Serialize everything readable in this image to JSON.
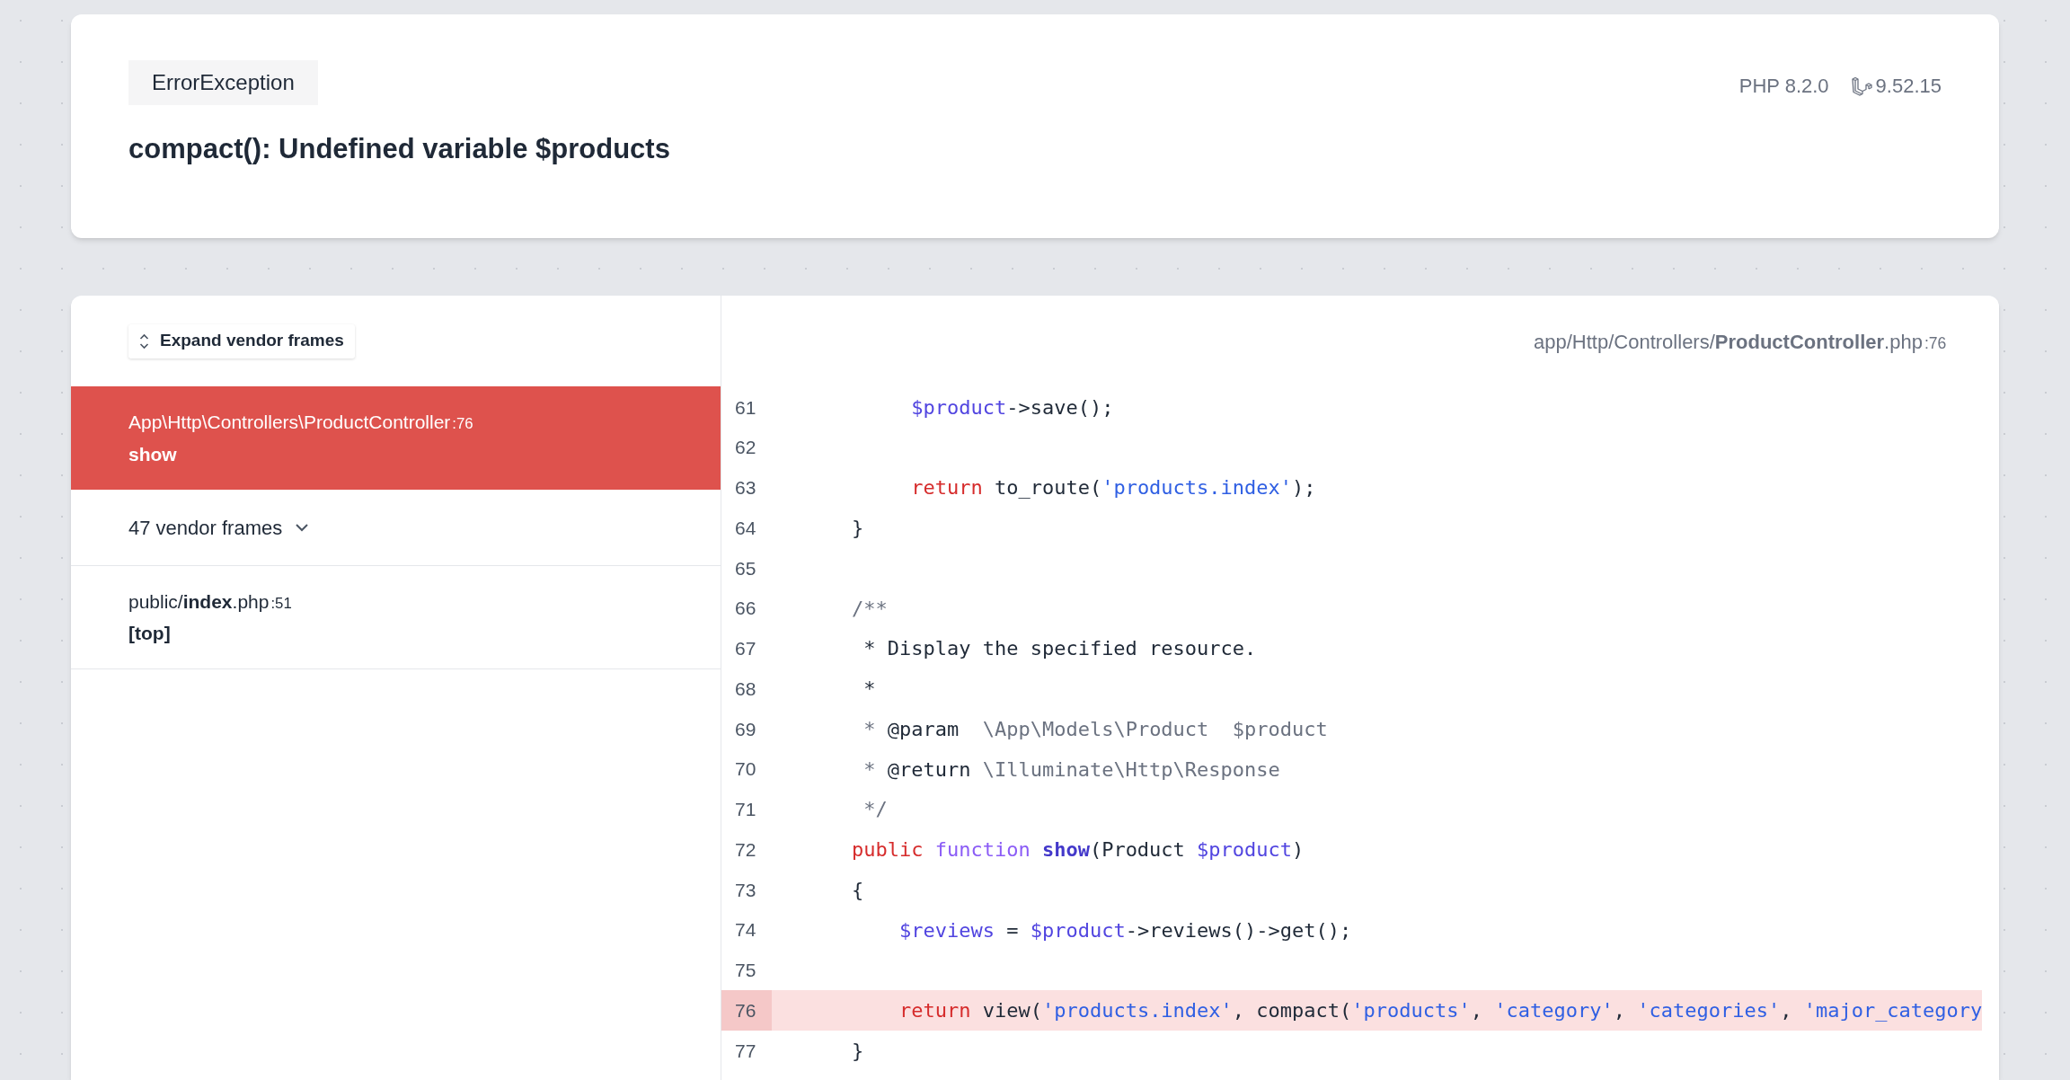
{
  "error": {
    "type": "ErrorException",
    "message": "compact(): Undefined variable $products",
    "php_version": "PHP 8.2.0",
    "laravel_version": "9.52.15"
  },
  "frames_panel": {
    "expand_button": "Expand vendor frames",
    "frames": [
      {
        "kind": "frame",
        "file": "App\\Http\\Controllers\\ProductController",
        "line": ":76",
        "method": "show",
        "selected": true
      },
      {
        "kind": "vendor_group",
        "label": "47 vendor frames",
        "expanded": false
      },
      {
        "kind": "frame",
        "file": "public/**index**.php",
        "line": ":51",
        "method": "[top]",
        "selected": false
      }
    ]
  },
  "code": {
    "file": "app/Http/Controllers/**ProductController**.php",
    "line": ":76",
    "lines": [
      {
        "number": "61",
        "highlighted": false,
        "tokens": [
          {
            "kind": "var",
            "text": "         $product"
          },
          {
            "kind": "plain",
            "text": "->save();"
          }
        ]
      },
      {
        "number": "62",
        "highlighted": false
      },
      {
        "number": "63",
        "highlighted": false,
        "tokens": [
          {
            "kind": "keyword",
            "text": "         return"
          },
          {
            "kind": "plain",
            "text": " to_route("
          },
          {
            "kind": "string",
            "text": "'products.index'"
          },
          {
            "kind": "plain",
            "text": ");"
          }
        ]
      },
      {
        "number": "64",
        "highlighted": false,
        "tokens": [
          {
            "kind": "plain",
            "text": "    }"
          }
        ]
      },
      {
        "number": "65",
        "highlighted": false
      },
      {
        "number": "66",
        "highlighted": false,
        "tokens": [
          {
            "kind": "comment",
            "text": "    /**"
          }
        ]
      },
      {
        "number": "67",
        "highlighted": false,
        "tokens": [
          {
            "kind": "plain",
            "text": "     * Display the specified resource."
          }
        ]
      },
      {
        "number": "68",
        "highlighted": false,
        "tokens": [
          {
            "kind": "plain",
            "text": "     *"
          }
        ]
      },
      {
        "number": "69",
        "highlighted": false,
        "tokens": [
          {
            "kind": "comment",
            "text": "     * "
          },
          {
            "kind": "plain",
            "text": "@param"
          },
          {
            "kind": "comment",
            "text": "  \\App\\Models\\Product  $product"
          }
        ]
      },
      {
        "number": "70",
        "highlighted": false,
        "tokens": [
          {
            "kind": "comment",
            "text": "     * "
          },
          {
            "kind": "plain",
            "text": "@return"
          },
          {
            "kind": "comment",
            "text": " \\Illuminate\\Http\\Response"
          }
        ]
      },
      {
        "number": "71",
        "highlighted": false,
        "tokens": [
          {
            "kind": "comment",
            "text": "     */"
          }
        ]
      },
      {
        "number": "72",
        "highlighted": false,
        "tokens": [
          {
            "kind": "keyword",
            "text": "    public"
          },
          {
            "kind": "function",
            "text": " function "
          },
          {
            "kind": "name",
            "text": "show"
          },
          {
            "kind": "plain",
            "text": "(Product "
          },
          {
            "kind": "var",
            "text": "$product"
          },
          {
            "kind": "plain",
            "text": ")"
          }
        ]
      },
      {
        "number": "73",
        "highlighted": false,
        "tokens": [
          {
            "kind": "plain",
            "text": "    {"
          }
        ]
      },
      {
        "number": "74",
        "highlighted": false,
        "tokens": [
          {
            "kind": "var",
            "text": "        $reviews"
          },
          {
            "kind": "plain",
            "text": " = "
          },
          {
            "kind": "var",
            "text": "$product"
          },
          {
            "kind": "plain",
            "text": "->reviews()->get();"
          }
        ]
      },
      {
        "number": "75",
        "highlighted": false
      },
      {
        "number": "76",
        "highlighted": true,
        "tokens": [
          {
            "kind": "keyword",
            "text": "        return"
          },
          {
            "kind": "plain",
            "text": " view("
          },
          {
            "kind": "string",
            "text": "'products.index'"
          },
          {
            "kind": "plain",
            "text": ", compact("
          },
          {
            "kind": "string",
            "text": "'products'"
          },
          {
            "kind": "plain",
            "text": ", "
          },
          {
            "kind": "string",
            "text": "'category'"
          },
          {
            "kind": "plain",
            "text": ", "
          },
          {
            "kind": "string",
            "text": "'categories'"
          },
          {
            "kind": "plain",
            "text": ", "
          },
          {
            "kind": "string",
            "text": "'major_category"
          }
        ]
      },
      {
        "number": "77",
        "highlighted": false,
        "tokens": [
          {
            "kind": "plain",
            "text": "    }"
          }
        ]
      }
    ]
  }
}
